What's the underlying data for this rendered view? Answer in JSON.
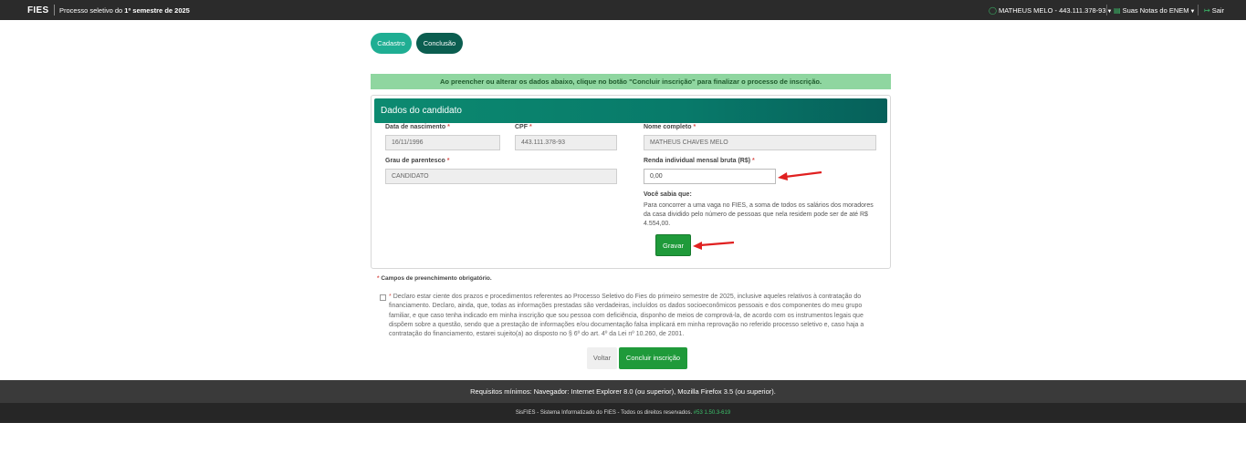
{
  "header": {
    "brand": "FIES",
    "subtitle_prefix": "Processo seletivo do ",
    "subtitle_bold": "1º semestre de 2025",
    "user": "MATHEUS MELO - 443.111.378-93",
    "notas": "Suas Notas do ENEM",
    "sair": "Sair"
  },
  "steps": [
    "Cadastro",
    "Conclusão"
  ],
  "alert": "Ao preencher ou alterar os dados abaixo, clique no botão \"Concluir inscrição\" para finalizar o processo de inscrição.",
  "panel": {
    "title": "Dados do candidato",
    "fields": {
      "nascimento": {
        "label": "Data de nascimento",
        "value": "16/11/1996"
      },
      "cpf": {
        "label": "CPF",
        "value": "443.111.378-93"
      },
      "nome": {
        "label": "Nome completo",
        "value": "MATHEUS CHAVES MELO"
      },
      "parentesco": {
        "label": "Grau de parentesco",
        "value": "CANDIDATO"
      },
      "renda": {
        "label": "Renda individual mensal bruta (R$)",
        "value": "0,00"
      }
    },
    "required_mark": "*",
    "info_title": "Você sabia que:",
    "info_text": "Para concorrer a uma vaga no FIES, a soma de todos os salários dos moradores da casa dividido pelo número de pessoas que nela residem pode ser de até R$ 4.554,00.",
    "save_button": "Gravar"
  },
  "mandatory_note": "Campos de preenchimento obrigatório.",
  "declaration": "Declaro estar ciente dos prazos e procedimentos referentes ao Processo Seletivo do Fies do primeiro semestre de 2025, inclusive aqueles relativos à contratação do financiamento. Declaro, ainda, que, todas as informações prestadas são verdadeiras, incluídos os dados socioeconômicos pessoais e dos componentes do meu grupo familiar, e que caso tenha indicado em minha inscrição que sou pessoa com deficiência, disponho de meios de comprová-la, de acordo com os instrumentos legais que dispõem sobre a questão, sendo que a prestação de informações e/ou documentação falsa implicará em minha reprovação no referido processo seletivo e, caso haja a contratação do financiamento, estarei sujeito(a) ao disposto no § 6º do art. 4º da Lei nº 10.260, de 2001.",
  "buttons": {
    "back": "Voltar",
    "submit": "Concluir inscrição"
  },
  "footer": {
    "requirements": "Requisitos mínimos: Navegador: Internet Explorer 8.0 (ou superior), Mozilla Firefox 3.5 (ou superior).",
    "copyright": "SisFIES - Sistema Informatizado do FIES - Todos os direitos reservados.",
    "version": "#53 1.50.3-619"
  },
  "colors": {
    "accent_green": "#1f9a3a",
    "teal_header": "#0c8a70",
    "alert_bg": "#8fd6a0",
    "arrow_red": "#e02020"
  }
}
